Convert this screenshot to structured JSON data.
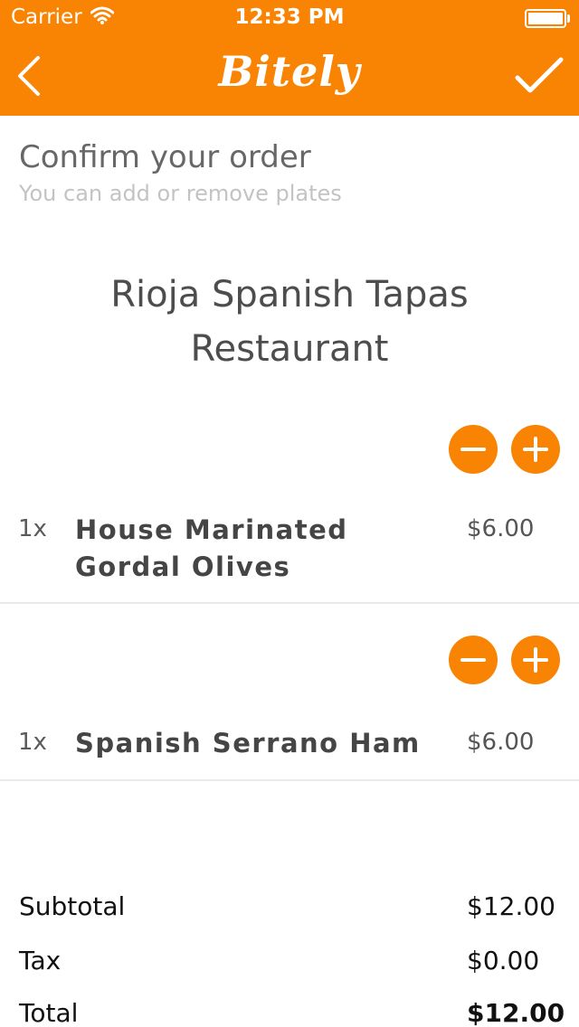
{
  "status_bar": {
    "carrier": "Carrier",
    "time": "12:33 PM"
  },
  "nav": {
    "title": "Bitely",
    "back_icon": "chevron-left-icon",
    "confirm_icon": "checkmark-icon"
  },
  "heading": "Confirm your order",
  "subheading": "You can add or remove plates",
  "restaurant_name": "Rioja Spanish Tapas Restaurant",
  "plates": [
    {
      "qty": "1x",
      "name": "House Marinated Gordal Olives",
      "price": "$6.00"
    },
    {
      "qty": "1x",
      "name": "Spanish Serrano Ham",
      "price": "$6.00"
    }
  ],
  "totals": {
    "subtotal_label": "Subtotal",
    "subtotal_value": "$12.00",
    "tax_label": "Tax",
    "tax_value": "$0.00",
    "total_label": "Total",
    "total_value": "$12.00"
  },
  "colors": {
    "accent": "#f98303",
    "text_dark": "#454545",
    "text_muted": "#c3c3c3",
    "divider": "#eaeaea"
  }
}
